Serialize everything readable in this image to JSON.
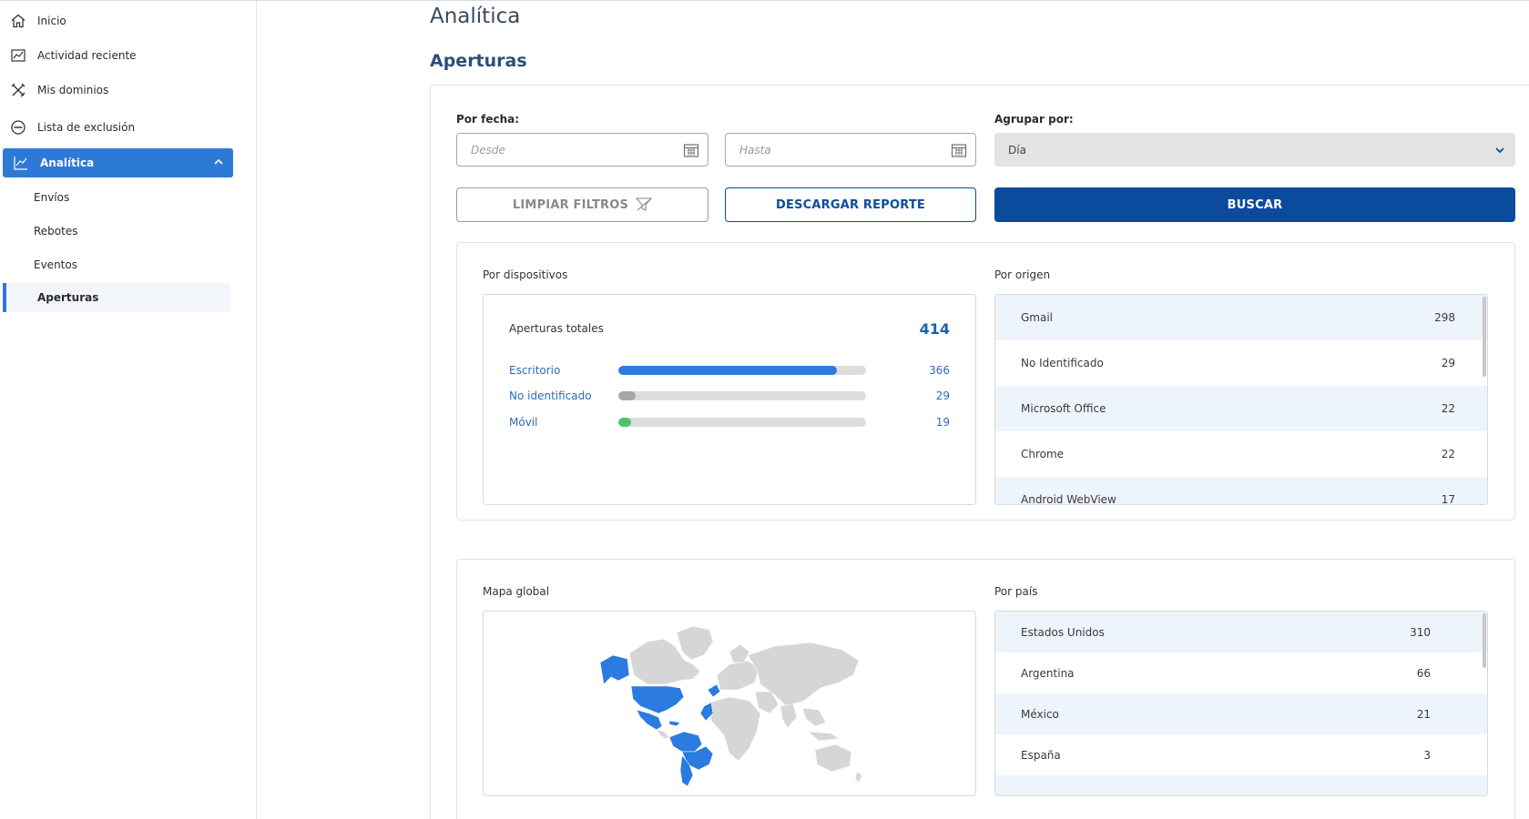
{
  "sidebar": {
    "items": [
      {
        "label": "Inicio",
        "icon": "home-icon"
      },
      {
        "label": "Actividad reciente",
        "icon": "activity-icon"
      },
      {
        "label": "Mis dominios",
        "icon": "tools-icon"
      },
      {
        "label": "Lista de exclusión",
        "icon": "block-icon"
      },
      {
        "label": "Analítica",
        "icon": "chart-line-icon"
      }
    ],
    "sub_items": [
      {
        "label": "Envíos"
      },
      {
        "label": "Rebotes"
      },
      {
        "label": "Eventos"
      },
      {
        "label": "Aperturas"
      }
    ]
  },
  "page": {
    "title": "Analítica",
    "section": "Aperturas"
  },
  "filters": {
    "date_label": "Por fecha:",
    "from_placeholder": "Desde",
    "to_placeholder": "Hasta",
    "group_label": "Agrupar por:",
    "group_value": "Día",
    "clear_button": "LIMPIAR FILTROS",
    "download_button": "DESCARGAR REPORTE",
    "search_button": "BUSCAR"
  },
  "devices": {
    "label": "Por dispositivos",
    "total_label": "Aperturas totales",
    "total_value": "414",
    "rows": [
      {
        "name": "Escritorio",
        "value": "366",
        "fraction": 0.884,
        "color": "#2b7be0"
      },
      {
        "name": "No identificado",
        "value": "29",
        "fraction": 0.07,
        "color": "#a6a6a6"
      },
      {
        "name": "Móvil",
        "value": "19",
        "fraction": 0.046,
        "color": "#4cc46a"
      }
    ]
  },
  "origin": {
    "label": "Por origen",
    "rows": [
      {
        "name": "Gmail",
        "value": "298"
      },
      {
        "name": "No Identificado",
        "value": "29"
      },
      {
        "name": "Microsoft Office",
        "value": "22"
      },
      {
        "name": "Chrome",
        "value": "22"
      },
      {
        "name": "Android WebView",
        "value": "17"
      }
    ]
  },
  "map": {
    "label": "Mapa global",
    "highlight_color": "#2b7be0",
    "base_color": "#d6d6d6"
  },
  "country": {
    "label": "Por país",
    "rows": [
      {
        "name": "Estados Unidos",
        "value": "310"
      },
      {
        "name": "Argentina",
        "value": "66"
      },
      {
        "name": "México",
        "value": "21"
      },
      {
        "name": "España",
        "value": "3"
      },
      {
        "name": "",
        "value": ""
      }
    ]
  }
}
